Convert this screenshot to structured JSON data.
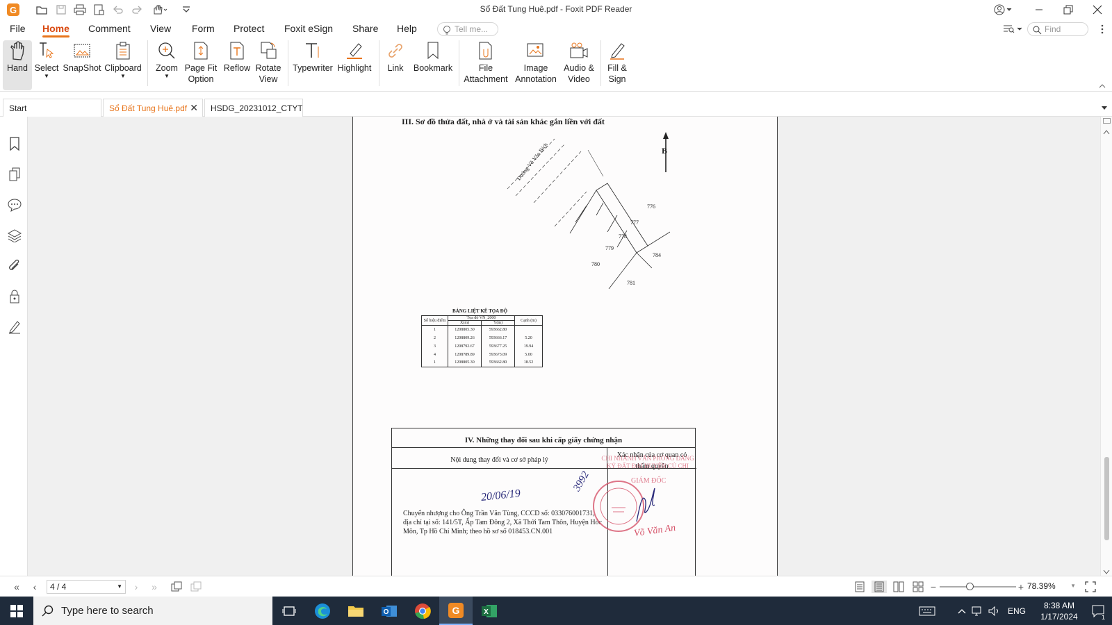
{
  "window": {
    "title": "Sổ Đất Tung Huê.pdf - Foxit PDF Reader",
    "accent": "#e8741a"
  },
  "menu": [
    "File",
    "Home",
    "Comment",
    "View",
    "Form",
    "Protect",
    "Foxit eSign",
    "Share",
    "Help"
  ],
  "tell_me": {
    "placeholder": "Tell me..."
  },
  "find": {
    "placeholder": "Find"
  },
  "ribbon": [
    {
      "label": "Hand",
      "icon": "hand-icon"
    },
    {
      "label": "Select",
      "icon": "select-icon"
    },
    {
      "label": "SnapShot",
      "icon": "snapshot-icon"
    },
    {
      "label": "Clipboard",
      "icon": "clipboard-icon"
    },
    {
      "label": "Zoom",
      "icon": "zoom-icon"
    },
    {
      "label": "Page Fit Option",
      "icon": "page-fit-icon"
    },
    {
      "label": "Reflow",
      "icon": "reflow-icon"
    },
    {
      "label": "Rotate View",
      "icon": "rotate-icon"
    },
    {
      "label": "Typewriter",
      "icon": "typewriter-icon"
    },
    {
      "label": "Highlight",
      "icon": "highlight-icon"
    },
    {
      "label": "Link",
      "icon": "link-icon"
    },
    {
      "label": "Bookmark",
      "icon": "bookmark-icon"
    },
    {
      "label": "File Attachment",
      "icon": "file-attachment-icon"
    },
    {
      "label": "Image Annotation",
      "icon": "image-annotation-icon"
    },
    {
      "label": "Audio & Video",
      "icon": "audio-video-icon"
    },
    {
      "label": "Fill & Sign",
      "icon": "fill-sign-icon"
    }
  ],
  "tabs": [
    "Start",
    "Sổ Đất Tung Huê.pdf",
    "HSDG_20231012_CTYT..."
  ],
  "document": {
    "section3_title": "III. Sơ đồ thửa đất, nhà ở và tài sản khác gắn liền với đất",
    "road_label": "Đường Võ Văn Bích",
    "north": "B",
    "parcels": [
      "776",
      "777",
      "778",
      "779",
      "780",
      "781",
      "784"
    ],
    "table_title": "BẢNG LIỆT KÊ TỌA ĐỘ",
    "table_headers": [
      "Số hiệu điểm",
      "Tọa độ VN_2000",
      "Cạnh (m)"
    ],
    "table_subheaders": [
      "X(m)",
      "Y(m)"
    ],
    "table_rows": [
      [
        "1",
        "1208805.30",
        "593662.80",
        ""
      ],
      [
        "2",
        "1208809.26",
        "593666.17",
        "5.20"
      ],
      [
        "3",
        "1208792.67",
        "593677.25",
        "19.94"
      ],
      [
        "4",
        "1208789.89",
        "593673.09",
        "5.00"
      ],
      [
        "1",
        "1208805.30",
        "593662.80",
        "18.52"
      ]
    ],
    "section4_title": "IV. Những thay đổi sau khi cấp giấy chứng nhận",
    "col_left": "Nội dung thay đổi và cơ sở pháp lý",
    "col_right": "Xác nhận của cơ quan có thẩm quyền",
    "date_handwritten": "20/06/19",
    "number_handwritten": "3992",
    "transfer_text": "Chuyển nhượng cho Ông Trần Văn Tùng, CCCD số: 033076001731, địa chỉ tại số: 141/5T, Ấp Tam Đông 2, Xã Thới Tam Thôn, Huyện Hóc Môn, Tp Hồ Chí Minh; theo hồ sơ số 018453.CN.001",
    "stamp_text": "CHI NHÁNH VĂN PHÒNG ĐĂNG KÝ ĐẤT ĐAI HUYỆN CỦ CHI",
    "signer_title": "GIÁM ĐỐC",
    "signer_name": "Võ Văn An"
  },
  "status": {
    "page": "4 / 4",
    "zoom": "78.39%"
  },
  "taskbar": {
    "search_placeholder": "Type here to search",
    "lang": "ENG",
    "time": "8:38 AM",
    "date": "1/17/2024",
    "notifications": "1"
  }
}
